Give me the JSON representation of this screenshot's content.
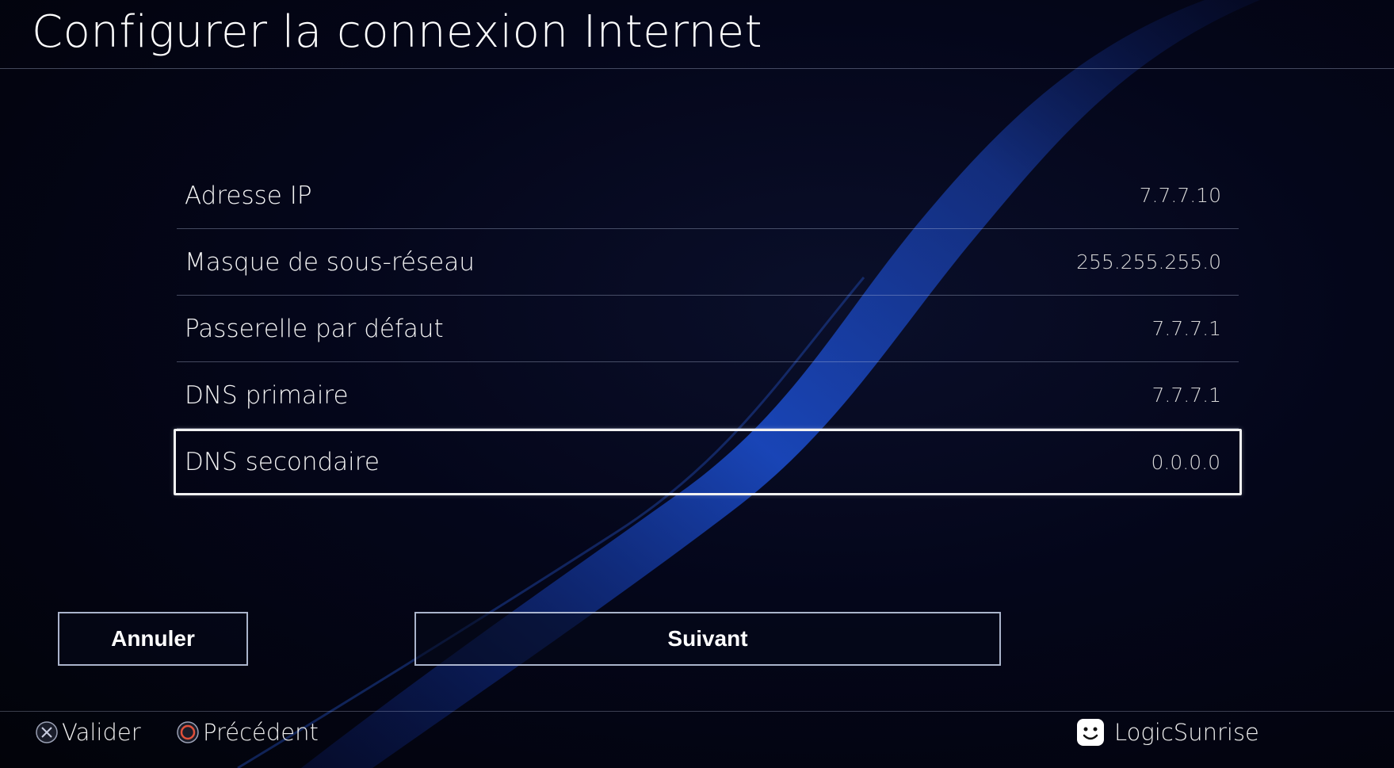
{
  "header": {
    "title": "Configurer la connexion Internet"
  },
  "settings": [
    {
      "label": "Adresse IP",
      "value": "7.7.7.10"
    },
    {
      "label": "Masque de sous-réseau",
      "value": "255.255.255.0"
    },
    {
      "label": "Passerelle par défaut",
      "value": "7.7.7.1"
    },
    {
      "label": "DNS primaire",
      "value": "7.7.7.1"
    },
    {
      "label": "DNS secondaire",
      "value": "0.0.0.0",
      "selected": true
    }
  ],
  "actions": {
    "cancel_label": "Annuler",
    "next_label": "Suivant"
  },
  "footer": {
    "validate_label": "Valider",
    "validate_icon": "cross-button-icon",
    "back_label": "Précédent",
    "back_icon": "circle-button-icon",
    "user_name": "LogicSunrise",
    "user_icon": "user-avatar-icon"
  },
  "colors": {
    "background": "#03040c",
    "wave": "#1a4fd0",
    "circle_button": "#e0503a"
  }
}
